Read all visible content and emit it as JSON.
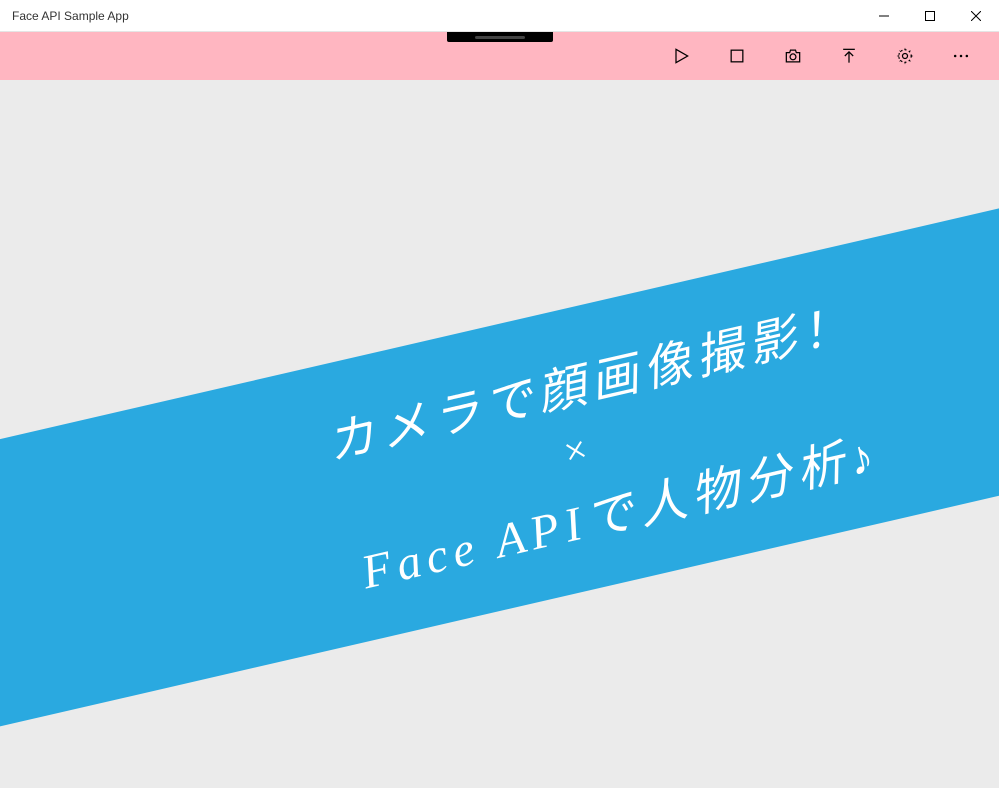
{
  "window": {
    "title": "Face API Sample App"
  },
  "toolbar": {
    "icons": {
      "play": "play-icon",
      "stop": "stop-icon",
      "camera": "camera-icon",
      "upload": "upload-icon",
      "settings": "settings-icon",
      "more": "more-icon"
    }
  },
  "content": {
    "banner": {
      "line1": "カメラで顔画像撮影！",
      "separator": "×",
      "line2": "Face APIで人物分析♪"
    }
  },
  "colors": {
    "toolbar_bg": "#ffb6c1",
    "banner_bg": "#2aa9e0",
    "content_bg": "#ebebeb"
  }
}
